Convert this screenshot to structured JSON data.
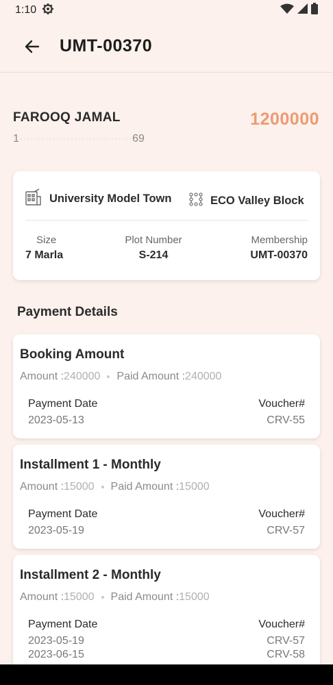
{
  "status": {
    "time": "1:10"
  },
  "header": {
    "title": "UMT-00370"
  },
  "owner": {
    "name": "FAROOQ JAMAL",
    "phone_prefix": "1",
    "phone_masked": "·······························",
    "phone_suffix": "69",
    "price": "1200000"
  },
  "plot": {
    "society": "University Model Town",
    "block": "ECO Valley Block",
    "size_label": "Size",
    "size_value": "7 Marla",
    "plot_label": "Plot Number",
    "plot_value": "S-214",
    "membership_label": "Membership",
    "membership_value": "UMT-00370"
  },
  "payment_section": {
    "title": "Payment Details"
  },
  "labels": {
    "amount": "Amount : ",
    "paid_amount": "Paid Amount : ",
    "payment_date": "Payment Date",
    "voucher": "Voucher#"
  },
  "payments": [
    {
      "title": "Booking Amount",
      "amount": "240000",
      "paid": "240000",
      "dates": [
        "2023-05-13"
      ],
      "vouchers": [
        "CRV-55"
      ]
    },
    {
      "title": "Installment 1 - Monthly",
      "amount": "15000",
      "paid": "15000",
      "dates": [
        "2023-05-19"
      ],
      "vouchers": [
        "CRV-57"
      ]
    },
    {
      "title": "Installment 2 - Monthly",
      "amount": "15000",
      "paid": "15000",
      "dates": [
        "2023-05-19",
        "2023-06-15"
      ],
      "vouchers": [
        "CRV-57",
        "CRV-58"
      ]
    }
  ],
  "colors": {
    "accent": "#ee9a72",
    "background": "#fcf1ec"
  }
}
